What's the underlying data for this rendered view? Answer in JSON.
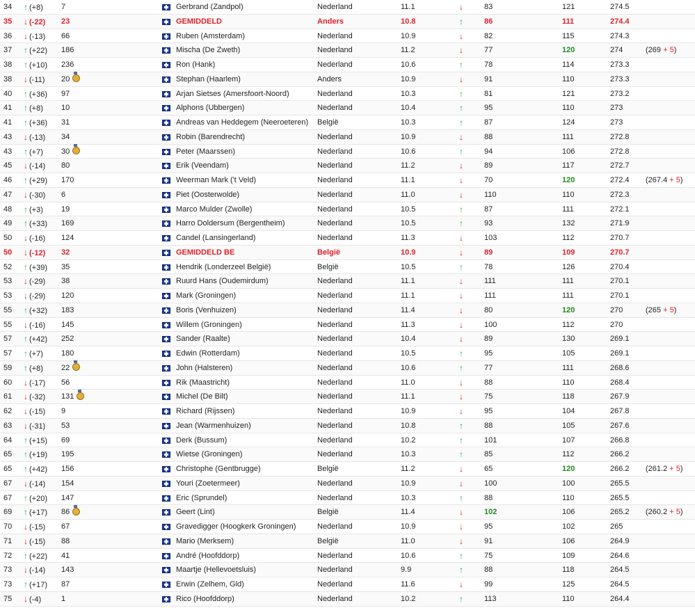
{
  "rows": [
    {
      "rank": "34",
      "dir": "up",
      "trend": "(+8)",
      "prev": "7",
      "medal": false,
      "name": "Gerbrand (Zandpol)",
      "country": "Nederland",
      "score": "11.1",
      "dir2": "down",
      "v2": "83",
      "v3": "121",
      "total": "274.5",
      "highlight": false
    },
    {
      "rank": "35",
      "dir": "down",
      "trend": "(-22)",
      "prev": "23",
      "medal": false,
      "name": "GEMIDDELD",
      "country": "Anders",
      "score": "10.8",
      "dir2": "up",
      "v2": "86",
      "v3": "111",
      "total": "274.4",
      "highlight": true
    },
    {
      "rank": "36",
      "dir": "down",
      "trend": "(-13)",
      "prev": "66",
      "medal": false,
      "name": "Ruben (Amsterdam)",
      "country": "Nederland",
      "score": "10.9",
      "dir2": "down",
      "v2": "82",
      "v3": "115",
      "total": "274.3",
      "highlight": false
    },
    {
      "rank": "37",
      "dir": "up",
      "trend": "(+22)",
      "prev": "186",
      "medal": false,
      "name": "Mischa (De Zweth)",
      "country": "Nederland",
      "score": "11.2",
      "dir2": "down",
      "v2": "77",
      "v3": "120",
      "v3green": true,
      "total": "274",
      "note_a": "(269",
      "note_b": "+ 5",
      "note_c": ")",
      "highlight": false
    },
    {
      "rank": "38",
      "dir": "up",
      "trend": "(+10)",
      "prev": "236",
      "medal": false,
      "name": "Ron (Hank)",
      "country": "Nederland",
      "score": "10.6",
      "dir2": "up",
      "v2": "78",
      "v3": "114",
      "total": "273.3",
      "highlight": false
    },
    {
      "rank": "38",
      "dir": "down",
      "trend": "(-11)",
      "prev": "20",
      "medal": true,
      "name": "Stephan (Haarlem)",
      "country": "Anders",
      "score": "10.9",
      "dir2": "down",
      "v2": "91",
      "v3": "110",
      "total": "273.3",
      "highlight": false
    },
    {
      "rank": "40",
      "dir": "up",
      "trend": "(+36)",
      "prev": "97",
      "medal": false,
      "name": "Arjan Sietses (Amersfoort-Noord)",
      "country": "Nederland",
      "score": "10.3",
      "dir2": "up",
      "v2": "81",
      "v3": "121",
      "total": "273.2",
      "highlight": false
    },
    {
      "rank": "41",
      "dir": "up",
      "trend": "(+8)",
      "prev": "10",
      "medal": false,
      "name": "Alphons (Ubbergen)",
      "country": "Nederland",
      "score": "10.4",
      "dir2": "up",
      "v2": "95",
      "v3": "110",
      "total": "273",
      "highlight": false
    },
    {
      "rank": "41",
      "dir": "up",
      "trend": "(+36)",
      "prev": "31",
      "medal": false,
      "name": "Andreas van Heddegem (Neeroeteren)",
      "country": "België",
      "score": "10.3",
      "dir2": "up",
      "v2": "87",
      "v3": "124",
      "total": "273",
      "highlight": false
    },
    {
      "rank": "43",
      "dir": "down",
      "trend": "(-13)",
      "prev": "34",
      "medal": false,
      "name": "Robin (Barendrecht)",
      "country": "Nederland",
      "score": "10.9",
      "dir2": "down",
      "v2": "88",
      "v3": "111",
      "total": "272.8",
      "highlight": false
    },
    {
      "rank": "43",
      "dir": "up",
      "trend": "(+7)",
      "prev": "30",
      "medal": true,
      "name": "Peter (Maarssen)",
      "country": "Nederland",
      "score": "10.6",
      "dir2": "up",
      "v2": "94",
      "v3": "106",
      "total": "272.8",
      "highlight": false
    },
    {
      "rank": "45",
      "dir": "down",
      "trend": "(-14)",
      "prev": "80",
      "medal": false,
      "name": "Erik (Veendam)",
      "country": "Nederland",
      "score": "11.2",
      "dir2": "down",
      "v2": "89",
      "v3": "117",
      "total": "272.7",
      "highlight": false
    },
    {
      "rank": "46",
      "dir": "up",
      "trend": "(+29)",
      "prev": "170",
      "medal": false,
      "name": "Weerman Mark ('t Veld)",
      "country": "Nederland",
      "score": "11.1",
      "dir2": "down",
      "v2": "70",
      "v3": "120",
      "v3green": true,
      "total": "272.4",
      "note_a": "(267.4",
      "note_b": "+ 5",
      "note_c": ")",
      "highlight": false
    },
    {
      "rank": "47",
      "dir": "down",
      "trend": "(-30)",
      "prev": "6",
      "medal": false,
      "name": "Piet (Oosterwolde)",
      "country": "Nederland",
      "score": "11.0",
      "dir2": "down",
      "v2": "110",
      "v3": "110",
      "total": "272.3",
      "highlight": false
    },
    {
      "rank": "48",
      "dir": "up",
      "trend": "(+3)",
      "prev": "19",
      "medal": false,
      "name": "Marco Mulder (Zwolle)",
      "country": "Nederland",
      "score": "10.5",
      "dir2": "up",
      "v2": "87",
      "v3": "111",
      "total": "272.1",
      "highlight": false
    },
    {
      "rank": "49",
      "dir": "up",
      "trend": "(+33)",
      "prev": "169",
      "medal": false,
      "name": "Harro Doldersum (Bergentheim)",
      "country": "Nederland",
      "score": "10.5",
      "dir2": "up",
      "v2": "93",
      "v3": "132",
      "total": "271.9",
      "highlight": false
    },
    {
      "rank": "50",
      "dir": "down",
      "trend": "(-16)",
      "prev": "124",
      "medal": false,
      "name": "Candel (Lansingerland)",
      "country": "Nederland",
      "score": "11.3",
      "dir2": "down",
      "v2": "103",
      "v3": "112",
      "total": "270.7",
      "highlight": false
    },
    {
      "rank": "50",
      "dir": "down",
      "trend": "(-12)",
      "prev": "32",
      "medal": false,
      "name": "GEMIDDELD BE",
      "country": "België",
      "score": "10.9",
      "dir2": "down",
      "v2": "89",
      "v3": "109",
      "total": "270.7",
      "highlight": true
    },
    {
      "rank": "52",
      "dir": "up",
      "trend": "(+39)",
      "prev": "35",
      "medal": false,
      "name": "Hendrik (Londerzeel België)",
      "country": "België",
      "score": "10.5",
      "dir2": "up",
      "v2": "78",
      "v3": "126",
      "total": "270.4",
      "highlight": false
    },
    {
      "rank": "53",
      "dir": "down",
      "trend": "(-29)",
      "prev": "38",
      "medal": false,
      "name": "Ruurd Hans (Oudemirdum)",
      "country": "Nederland",
      "score": "11.1",
      "dir2": "down",
      "v2": "111",
      "v3": "111",
      "total": "270.1",
      "highlight": false
    },
    {
      "rank": "53",
      "dir": "down",
      "trend": "(-29)",
      "prev": "120",
      "medal": false,
      "name": "Mark (Groningen)",
      "country": "Nederland",
      "score": "11.1",
      "dir2": "down",
      "v2": "111",
      "v3": "111",
      "total": "270.1",
      "highlight": false
    },
    {
      "rank": "55",
      "dir": "up",
      "trend": "(+32)",
      "prev": "183",
      "medal": false,
      "name": "Boris (Venhuizen)",
      "country": "Nederland",
      "score": "11.4",
      "dir2": "down",
      "v2": "80",
      "v3": "120",
      "v3green": true,
      "total": "270",
      "note_a": "(265",
      "note_b": "+ 5",
      "note_c": ")",
      "highlight": false
    },
    {
      "rank": "55",
      "dir": "down",
      "trend": "(-16)",
      "prev": "145",
      "medal": false,
      "name": "Willem (Groningen)",
      "country": "Nederland",
      "score": "11.3",
      "dir2": "down",
      "v2": "100",
      "v3": "112",
      "total": "270",
      "highlight": false
    },
    {
      "rank": "57",
      "dir": "up",
      "trend": "(+42)",
      "prev": "252",
      "medal": false,
      "name": "Sander (Raalte)",
      "country": "Nederland",
      "score": "10.4",
      "dir2": "down",
      "v2": "89",
      "v3": "130",
      "total": "269.1",
      "highlight": false
    },
    {
      "rank": "57",
      "dir": "up",
      "trend": "(+7)",
      "prev": "180",
      "medal": false,
      "name": "Edwin (Rotterdam)",
      "country": "Nederland",
      "score": "10.5",
      "dir2": "up",
      "v2": "95",
      "v3": "105",
      "total": "269.1",
      "highlight": false
    },
    {
      "rank": "59",
      "dir": "up",
      "trend": "(+8)",
      "prev": "22",
      "medal": true,
      "name": "John (Halsteren)",
      "country": "Nederland",
      "score": "10.6",
      "dir2": "up",
      "v2": "77",
      "v3": "111",
      "total": "268.6",
      "highlight": false
    },
    {
      "rank": "60",
      "dir": "down",
      "trend": "(-17)",
      "prev": "56",
      "medal": false,
      "name": "Rik (Maastricht)",
      "country": "Nederland",
      "score": "11.0",
      "dir2": "down",
      "v2": "88",
      "v3": "110",
      "total": "268.4",
      "highlight": false
    },
    {
      "rank": "61",
      "dir": "down",
      "trend": "(-32)",
      "prev": "131",
      "medal": true,
      "name": "Michel (De Bilt)",
      "country": "Nederland",
      "score": "11.1",
      "dir2": "down",
      "v2": "75",
      "v3": "118",
      "total": "267.9",
      "highlight": false
    },
    {
      "rank": "62",
      "dir": "down",
      "trend": "(-15)",
      "prev": "9",
      "medal": false,
      "name": "Richard (Rijssen)",
      "country": "Nederland",
      "score": "10.9",
      "dir2": "down",
      "v2": "95",
      "v3": "104",
      "total": "267.8",
      "highlight": false
    },
    {
      "rank": "63",
      "dir": "down",
      "trend": "(-31)",
      "prev": "53",
      "medal": false,
      "name": "Jean (Warmenhuizen)",
      "country": "Nederland",
      "score": "10.8",
      "dir2": "up",
      "v2": "88",
      "v3": "105",
      "total": "267.6",
      "highlight": false
    },
    {
      "rank": "64",
      "dir": "up",
      "trend": "(+15)",
      "prev": "69",
      "medal": false,
      "name": "Derk (Bussum)",
      "country": "Nederland",
      "score": "10.2",
      "dir2": "up",
      "v2": "101",
      "v3": "107",
      "total": "266.8",
      "highlight": false
    },
    {
      "rank": "65",
      "dir": "up",
      "trend": "(+19)",
      "prev": "195",
      "medal": false,
      "name": "Wietse (Groningen)",
      "country": "Nederland",
      "score": "10.3",
      "dir2": "up",
      "v2": "85",
      "v3": "112",
      "total": "266.2",
      "highlight": false
    },
    {
      "rank": "65",
      "dir": "up",
      "trend": "(+42)",
      "prev": "156",
      "medal": false,
      "name": "Christophe (Gentbrugge)",
      "country": "België",
      "score": "11.2",
      "dir2": "down",
      "v2": "65",
      "v3": "120",
      "v3green": true,
      "total": "266.2",
      "note_a": "(261.2",
      "note_b": "+ 5",
      "note_c": ")",
      "highlight": false
    },
    {
      "rank": "67",
      "dir": "down",
      "trend": "(-14)",
      "prev": "154",
      "medal": false,
      "name": "Youri (Zoetermeer)",
      "country": "Nederland",
      "score": "10.9",
      "dir2": "down",
      "v2": "100",
      "v3": "100",
      "total": "265.5",
      "highlight": false
    },
    {
      "rank": "67",
      "dir": "up",
      "trend": "(+20)",
      "prev": "147",
      "medal": false,
      "name": "Eric (Sprundel)",
      "country": "Nederland",
      "score": "10.3",
      "dir2": "up",
      "v2": "88",
      "v3": "110",
      "total": "265.5",
      "highlight": false
    },
    {
      "rank": "69",
      "dir": "up",
      "trend": "(+17)",
      "prev": "86",
      "medal": true,
      "name": "Geert (Lint)",
      "country": "België",
      "score": "11.4",
      "dir2": "down",
      "v2": "102",
      "v2green": true,
      "v3": "106",
      "total": "265.2",
      "note_a": "(260.2",
      "note_b": "+ 5",
      "note_c": ")",
      "highlight": false
    },
    {
      "rank": "70",
      "dir": "down",
      "trend": "(-15)",
      "prev": "67",
      "medal": false,
      "name": "Gravedigger (Hoogkerk Groningen)",
      "country": "Nederland",
      "score": "10.9",
      "dir2": "down",
      "v2": "95",
      "v3": "102",
      "total": "265",
      "highlight": false
    },
    {
      "rank": "71",
      "dir": "down",
      "trend": "(-15)",
      "prev": "88",
      "medal": false,
      "name": "Mario (Merksem)",
      "country": "België",
      "score": "11.0",
      "dir2": "down",
      "v2": "91",
      "v3": "106",
      "total": "264.9",
      "highlight": false
    },
    {
      "rank": "72",
      "dir": "up",
      "trend": "(+22)",
      "prev": "41",
      "medal": false,
      "name": "André (Hoofddorp)",
      "country": "Nederland",
      "score": "10.6",
      "dir2": "up",
      "v2": "75",
      "v3": "109",
      "total": "264.6",
      "highlight": false
    },
    {
      "rank": "73",
      "dir": "down",
      "trend": "(-14)",
      "prev": "143",
      "medal": false,
      "name": "Maartje (Hellevoetsluis)",
      "country": "Nederland",
      "score": "9.9",
      "dir2": "up",
      "v2": "88",
      "v3": "118",
      "total": "264.5",
      "highlight": false
    },
    {
      "rank": "73",
      "dir": "up",
      "trend": "(+17)",
      "prev": "87",
      "medal": false,
      "name": "Erwin (Zelhem, Gld)",
      "country": "Nederland",
      "score": "11.6",
      "dir2": "down",
      "v2": "99",
      "v3": "125",
      "total": "264.5",
      "highlight": false
    },
    {
      "rank": "75",
      "dir": "down",
      "trend": "(-4)",
      "prev": "1",
      "medal": false,
      "name": "Rico (Hoofddorp)",
      "country": "Nederland",
      "score": "10.2",
      "dir2": "up",
      "v2": "113",
      "v3": "110",
      "total": "264.4",
      "highlight": false
    }
  ],
  "icons": {
    "up": "arrow-up-icon",
    "down": "arrow-down-icon",
    "flag": "flag-icon",
    "medal": "medal-icon"
  },
  "colors": {
    "up": "#2fa84f",
    "down": "#d61f1f",
    "highlight": "#e0202a",
    "bonus": "#1f8a1f"
  }
}
